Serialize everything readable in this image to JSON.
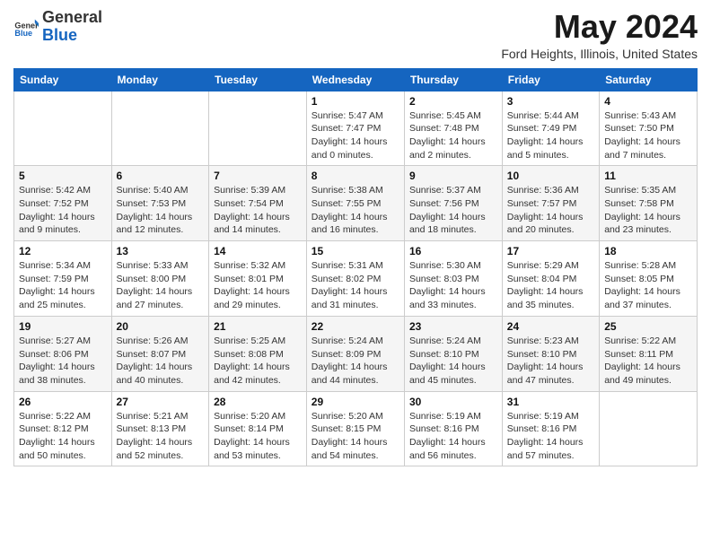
{
  "logo": {
    "general": "General",
    "blue": "Blue"
  },
  "header": {
    "month": "May 2024",
    "location": "Ford Heights, Illinois, United States"
  },
  "days_of_week": [
    "Sunday",
    "Monday",
    "Tuesday",
    "Wednesday",
    "Thursday",
    "Friday",
    "Saturday"
  ],
  "weeks": [
    [
      {
        "day": "",
        "info": ""
      },
      {
        "day": "",
        "info": ""
      },
      {
        "day": "",
        "info": ""
      },
      {
        "day": "1",
        "info": "Sunrise: 5:47 AM\nSunset: 7:47 PM\nDaylight: 14 hours and 0 minutes."
      },
      {
        "day": "2",
        "info": "Sunrise: 5:45 AM\nSunset: 7:48 PM\nDaylight: 14 hours and 2 minutes."
      },
      {
        "day": "3",
        "info": "Sunrise: 5:44 AM\nSunset: 7:49 PM\nDaylight: 14 hours and 5 minutes."
      },
      {
        "day": "4",
        "info": "Sunrise: 5:43 AM\nSunset: 7:50 PM\nDaylight: 14 hours and 7 minutes."
      }
    ],
    [
      {
        "day": "5",
        "info": "Sunrise: 5:42 AM\nSunset: 7:52 PM\nDaylight: 14 hours and 9 minutes."
      },
      {
        "day": "6",
        "info": "Sunrise: 5:40 AM\nSunset: 7:53 PM\nDaylight: 14 hours and 12 minutes."
      },
      {
        "day": "7",
        "info": "Sunrise: 5:39 AM\nSunset: 7:54 PM\nDaylight: 14 hours and 14 minutes."
      },
      {
        "day": "8",
        "info": "Sunrise: 5:38 AM\nSunset: 7:55 PM\nDaylight: 14 hours and 16 minutes."
      },
      {
        "day": "9",
        "info": "Sunrise: 5:37 AM\nSunset: 7:56 PM\nDaylight: 14 hours and 18 minutes."
      },
      {
        "day": "10",
        "info": "Sunrise: 5:36 AM\nSunset: 7:57 PM\nDaylight: 14 hours and 20 minutes."
      },
      {
        "day": "11",
        "info": "Sunrise: 5:35 AM\nSunset: 7:58 PM\nDaylight: 14 hours and 23 minutes."
      }
    ],
    [
      {
        "day": "12",
        "info": "Sunrise: 5:34 AM\nSunset: 7:59 PM\nDaylight: 14 hours and 25 minutes."
      },
      {
        "day": "13",
        "info": "Sunrise: 5:33 AM\nSunset: 8:00 PM\nDaylight: 14 hours and 27 minutes."
      },
      {
        "day": "14",
        "info": "Sunrise: 5:32 AM\nSunset: 8:01 PM\nDaylight: 14 hours and 29 minutes."
      },
      {
        "day": "15",
        "info": "Sunrise: 5:31 AM\nSunset: 8:02 PM\nDaylight: 14 hours and 31 minutes."
      },
      {
        "day": "16",
        "info": "Sunrise: 5:30 AM\nSunset: 8:03 PM\nDaylight: 14 hours and 33 minutes."
      },
      {
        "day": "17",
        "info": "Sunrise: 5:29 AM\nSunset: 8:04 PM\nDaylight: 14 hours and 35 minutes."
      },
      {
        "day": "18",
        "info": "Sunrise: 5:28 AM\nSunset: 8:05 PM\nDaylight: 14 hours and 37 minutes."
      }
    ],
    [
      {
        "day": "19",
        "info": "Sunrise: 5:27 AM\nSunset: 8:06 PM\nDaylight: 14 hours and 38 minutes."
      },
      {
        "day": "20",
        "info": "Sunrise: 5:26 AM\nSunset: 8:07 PM\nDaylight: 14 hours and 40 minutes."
      },
      {
        "day": "21",
        "info": "Sunrise: 5:25 AM\nSunset: 8:08 PM\nDaylight: 14 hours and 42 minutes."
      },
      {
        "day": "22",
        "info": "Sunrise: 5:24 AM\nSunset: 8:09 PM\nDaylight: 14 hours and 44 minutes."
      },
      {
        "day": "23",
        "info": "Sunrise: 5:24 AM\nSunset: 8:10 PM\nDaylight: 14 hours and 45 minutes."
      },
      {
        "day": "24",
        "info": "Sunrise: 5:23 AM\nSunset: 8:10 PM\nDaylight: 14 hours and 47 minutes."
      },
      {
        "day": "25",
        "info": "Sunrise: 5:22 AM\nSunset: 8:11 PM\nDaylight: 14 hours and 49 minutes."
      }
    ],
    [
      {
        "day": "26",
        "info": "Sunrise: 5:22 AM\nSunset: 8:12 PM\nDaylight: 14 hours and 50 minutes."
      },
      {
        "day": "27",
        "info": "Sunrise: 5:21 AM\nSunset: 8:13 PM\nDaylight: 14 hours and 52 minutes."
      },
      {
        "day": "28",
        "info": "Sunrise: 5:20 AM\nSunset: 8:14 PM\nDaylight: 14 hours and 53 minutes."
      },
      {
        "day": "29",
        "info": "Sunrise: 5:20 AM\nSunset: 8:15 PM\nDaylight: 14 hours and 54 minutes."
      },
      {
        "day": "30",
        "info": "Sunrise: 5:19 AM\nSunset: 8:16 PM\nDaylight: 14 hours and 56 minutes."
      },
      {
        "day": "31",
        "info": "Sunrise: 5:19 AM\nSunset: 8:16 PM\nDaylight: 14 hours and 57 minutes."
      },
      {
        "day": "",
        "info": ""
      }
    ]
  ]
}
